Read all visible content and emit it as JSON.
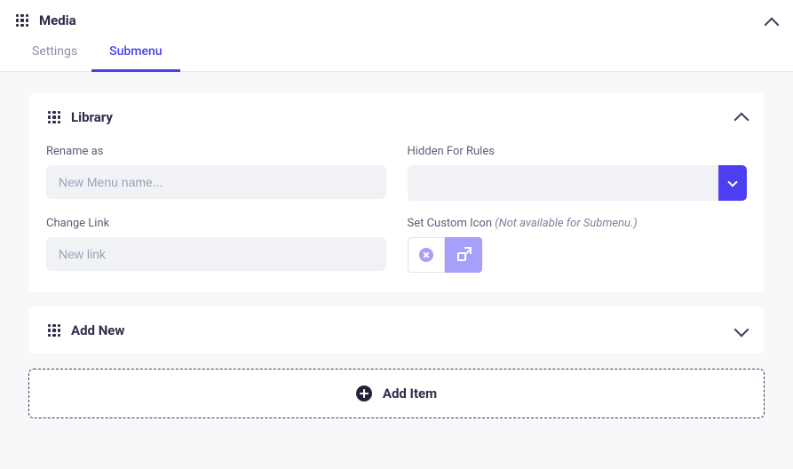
{
  "header": {
    "title": "Media",
    "tabs": [
      {
        "label": "Settings"
      },
      {
        "label": "Submenu"
      }
    ]
  },
  "library": {
    "title": "Library",
    "rename_label": "Rename as",
    "rename_placeholder": "New Menu name...",
    "hidden_label": "Hidden For Rules",
    "link_label": "Change Link",
    "link_placeholder": "New link",
    "icon_label": "Set Custom Icon ",
    "icon_note": "(Not available for Submenu.)"
  },
  "add_new": {
    "title": "Add New"
  },
  "add_item": {
    "label": "Add Item"
  }
}
